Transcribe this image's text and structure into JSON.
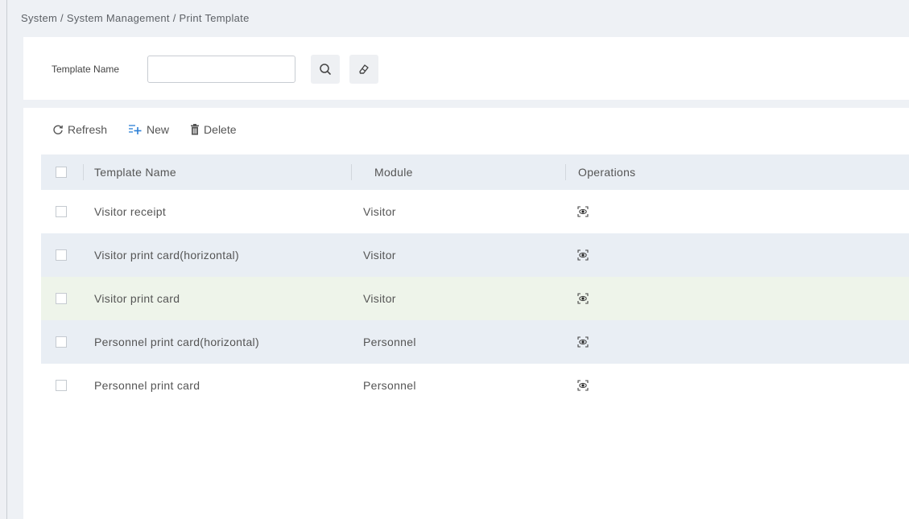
{
  "breadcrumb": "System / System Management / Print Template",
  "search": {
    "label": "Template Name",
    "value": "",
    "placeholder": ""
  },
  "toolbar": {
    "refresh_label": "Refresh",
    "new_label": "New",
    "delete_label": "Delete"
  },
  "table": {
    "columns": [
      "Template Name",
      "Module",
      "Operations"
    ],
    "rows": [
      {
        "name": "Visitor receipt",
        "module": "Visitor"
      },
      {
        "name": "Visitor print card(horizontal)",
        "module": "Visitor"
      },
      {
        "name": "Visitor print card",
        "module": "Visitor"
      },
      {
        "name": "Personnel print card(horizontal)",
        "module": "Personnel"
      },
      {
        "name": "Personnel print card",
        "module": "Personnel"
      }
    ]
  },
  "icons": {
    "search": "search-icon",
    "clear": "eraser-icon",
    "refresh": "refresh-icon",
    "new": "add-list-icon",
    "delete": "trash-icon",
    "view": "view-eye-icon"
  },
  "colors": {
    "header_bg": "#e9eef4",
    "hover_row_bg": "#eef4ea",
    "page_bg": "#eef1f5"
  }
}
